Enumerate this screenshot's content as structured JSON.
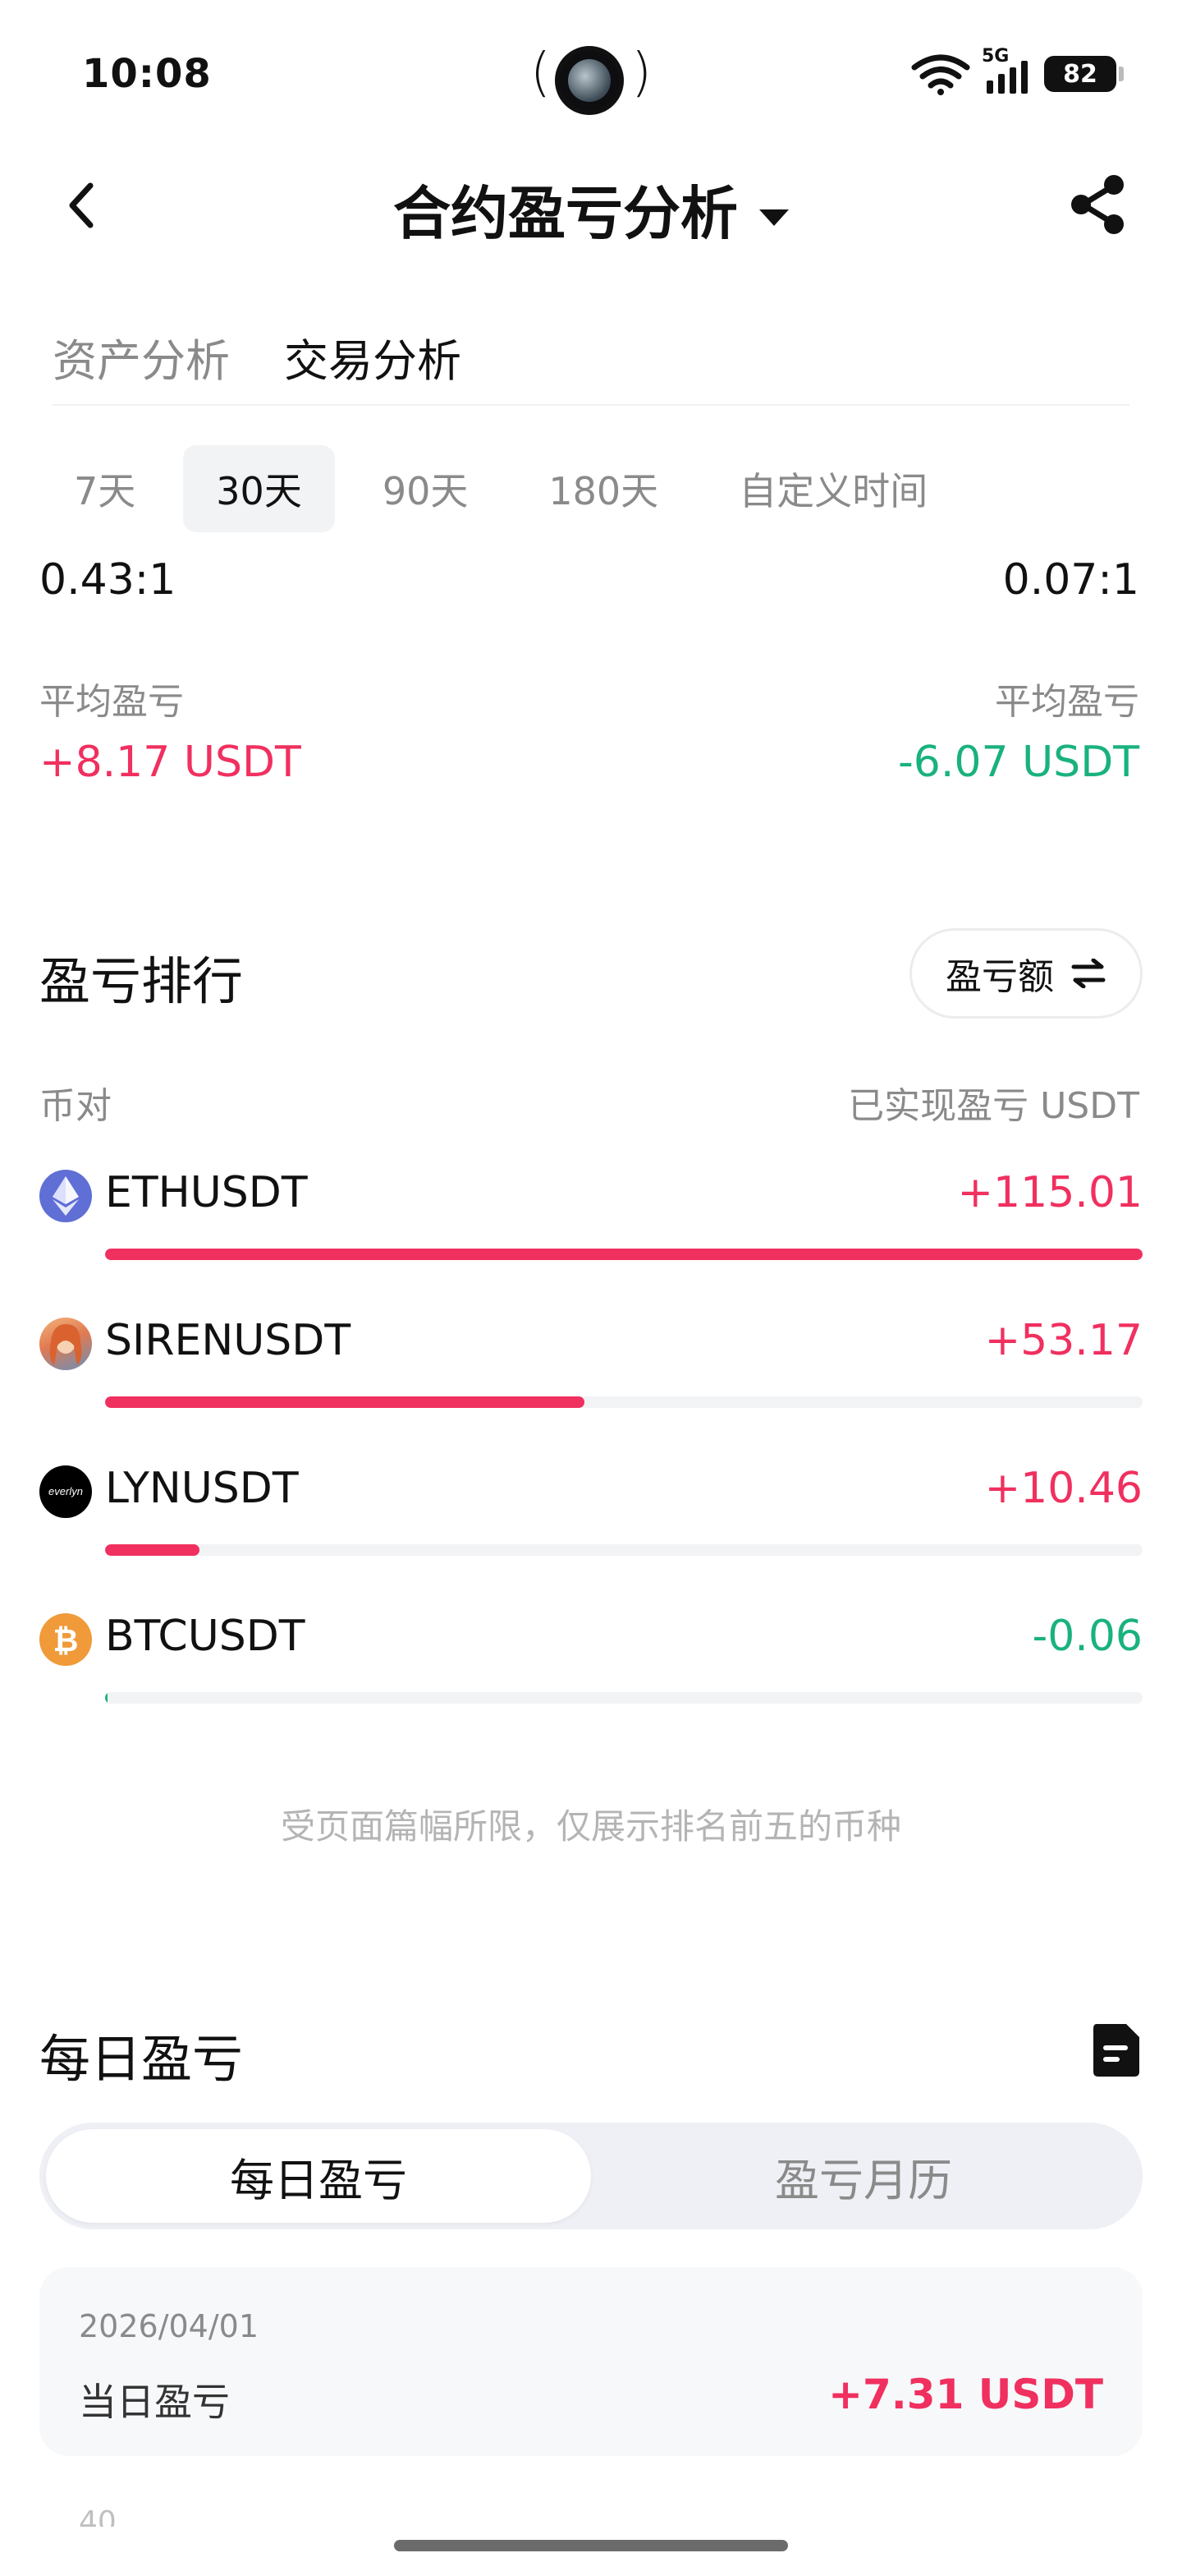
{
  "status_bar": {
    "time": "10:08",
    "network": "5G",
    "battery": "82"
  },
  "nav": {
    "title": "合约盈亏分析"
  },
  "main_tabs": [
    {
      "label": "资产分析",
      "active": false
    },
    {
      "label": "交易分析",
      "active": true
    }
  ],
  "periods": [
    {
      "label": "7天",
      "active": false
    },
    {
      "label": "30天",
      "active": true
    },
    {
      "label": "90天",
      "active": false
    },
    {
      "label": "180天",
      "active": false
    },
    {
      "label": "自定义时间",
      "active": false
    }
  ],
  "summary": {
    "ratio_left": "0.43:1",
    "ratio_right": "0.07:1",
    "avg_label_left": "平均盈亏",
    "avg_label_right": "平均盈亏",
    "avg_value_left": "+8.17 USDT",
    "avg_value_right": "-6.07 USDT"
  },
  "ranking": {
    "title": "盈亏排行",
    "sort_label": "盈亏额",
    "col_pair": "币对",
    "col_pnl": "已实现盈亏 USDT",
    "items": [
      {
        "symbol": "ETHUSDT",
        "value": "+115.01",
        "fill": 1.0,
        "icon": "ethereum-icon",
        "sign": "pos"
      },
      {
        "symbol": "SIRENUSDT",
        "value": "+53.17",
        "fill": 0.462,
        "icon": "siren-avatar-icon",
        "sign": "pos"
      },
      {
        "symbol": "LYNUSDT",
        "value": "+10.46",
        "fill": 0.091,
        "icon": "everlyn-logo-icon",
        "sign": "pos"
      },
      {
        "symbol": "BTCUSDT",
        "value": "-0.06",
        "fill": 0.001,
        "icon": "bitcoin-icon",
        "sign": "neg"
      }
    ],
    "note": "受页面篇幅所限，仅展示排名前五的币种"
  },
  "daily": {
    "title": "每日盈亏",
    "seg_daily": "每日盈亏",
    "seg_calendar": "盈亏月历",
    "card": {
      "date": "2026/04/01",
      "label": "当日盈亏",
      "value": "+7.31 USDT"
    },
    "next_hint": "40"
  },
  "colors": {
    "positive": "#f0305f",
    "negative": "#19b27d",
    "muted": "#8a8a8a"
  }
}
